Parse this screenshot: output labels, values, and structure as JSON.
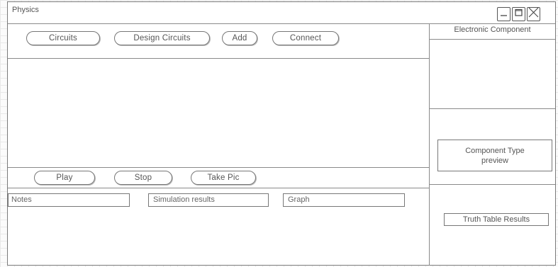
{
  "window": {
    "title": "Physics"
  },
  "toolbar_top": {
    "circuits": "Circuits",
    "design_circuits": "Design Circuits",
    "add": "Add",
    "connect": "Connect"
  },
  "toolbar_bottom": {
    "play": "Play",
    "stop": "Stop",
    "take_pic": "Take Pic"
  },
  "tabs": {
    "notes": "Notes",
    "simulation_results": "Simulation results",
    "graph": "Graph"
  },
  "right_panel": {
    "header": "Electronic Component",
    "preview_line1": "Component Type",
    "preview_line2": "preview",
    "truth_table": "Truth Table Results"
  },
  "icons": {
    "minimize": "minimize-icon",
    "maximize": "maximize-icon",
    "close": "close-icon"
  }
}
